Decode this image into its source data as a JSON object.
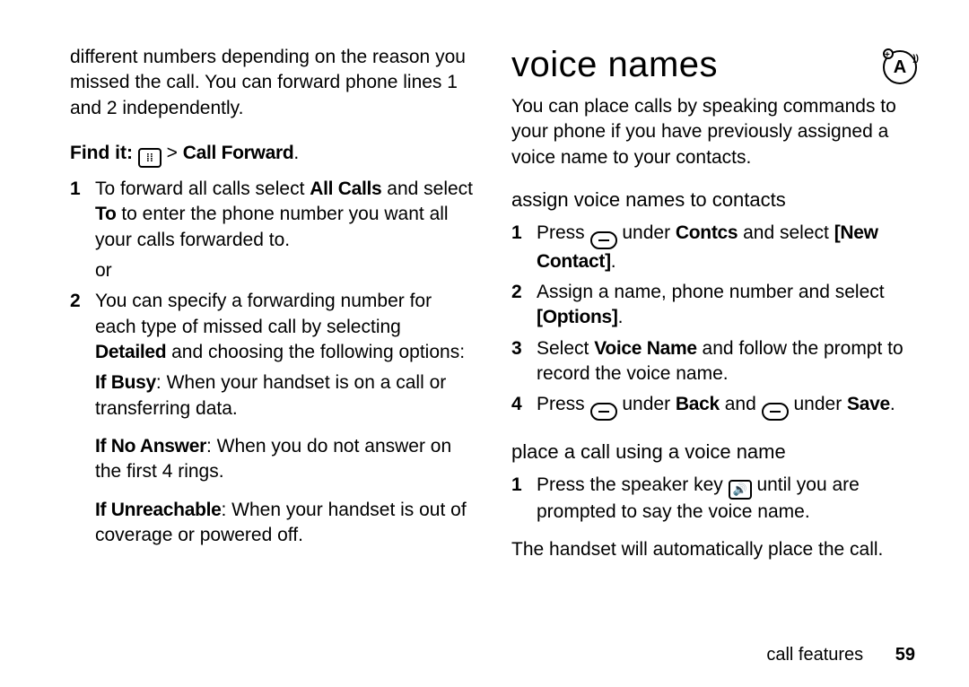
{
  "left": {
    "intro": "different numbers depending on the reason you missed the call. You can forward phone lines 1 and 2 independently.",
    "findit_label": "Find it:",
    "findit_path": "Call Forward",
    "steps": [
      {
        "n": "1",
        "pre": "To forward all calls select ",
        "bold1": "All Calls",
        "mid": " and select ",
        "bold2": "To",
        "post": " to enter the phone number you want all your calls forwarded to."
      }
    ],
    "or": "or",
    "step2": {
      "n": "2",
      "pre": "You can specify a forwarding number for each type of missed call by selecting ",
      "bold1": "Detailed",
      "post": " and choosing the following options:"
    },
    "opts": [
      {
        "label": "If Busy",
        "text": ": When your handset is on a call or transferring data."
      },
      {
        "label": "If No Answer",
        "text": ": When you do not answer on the first 4 rings."
      },
      {
        "label": "If Unreachable",
        "text": ": When your handset is out of coverage or powered off."
      }
    ]
  },
  "right": {
    "title": "voice names",
    "head_icon_letter": "A",
    "intro": "You can place calls by speaking commands to your phone if you have previously assigned a voice name to your contacts.",
    "h_assign": "assign voice names to contacts",
    "assign": {
      "s1_a": "Press ",
      "s1_b": " under ",
      "s1_c": "Contcs",
      "s1_d": " and select ",
      "s1_e": "[New Contact]",
      "s1_f": ".",
      "s2_a": "Assign a name, phone number and select ",
      "s2_b": "[Options]",
      "s2_c": ".",
      "s3_a": "Select ",
      "s3_b": "Voice Name",
      "s3_c": " and follow the prompt to record the voice name.",
      "s4_a": "Press ",
      "s4_b": " under ",
      "s4_c": "Back",
      "s4_d": " and ",
      "s4_e": " under ",
      "s4_f": "Save",
      "s4_g": "."
    },
    "h_place": "place a call using a voice name",
    "place": {
      "s1_a": "Press the speaker key ",
      "s1_b": " until you are prompted to say the voice name."
    },
    "outro": "The handset will automatically place the call."
  },
  "footer": {
    "label": "call features",
    "page": "59"
  },
  "glyphs": {
    "grid": "⁞⁞",
    "speaker": "🔊"
  }
}
